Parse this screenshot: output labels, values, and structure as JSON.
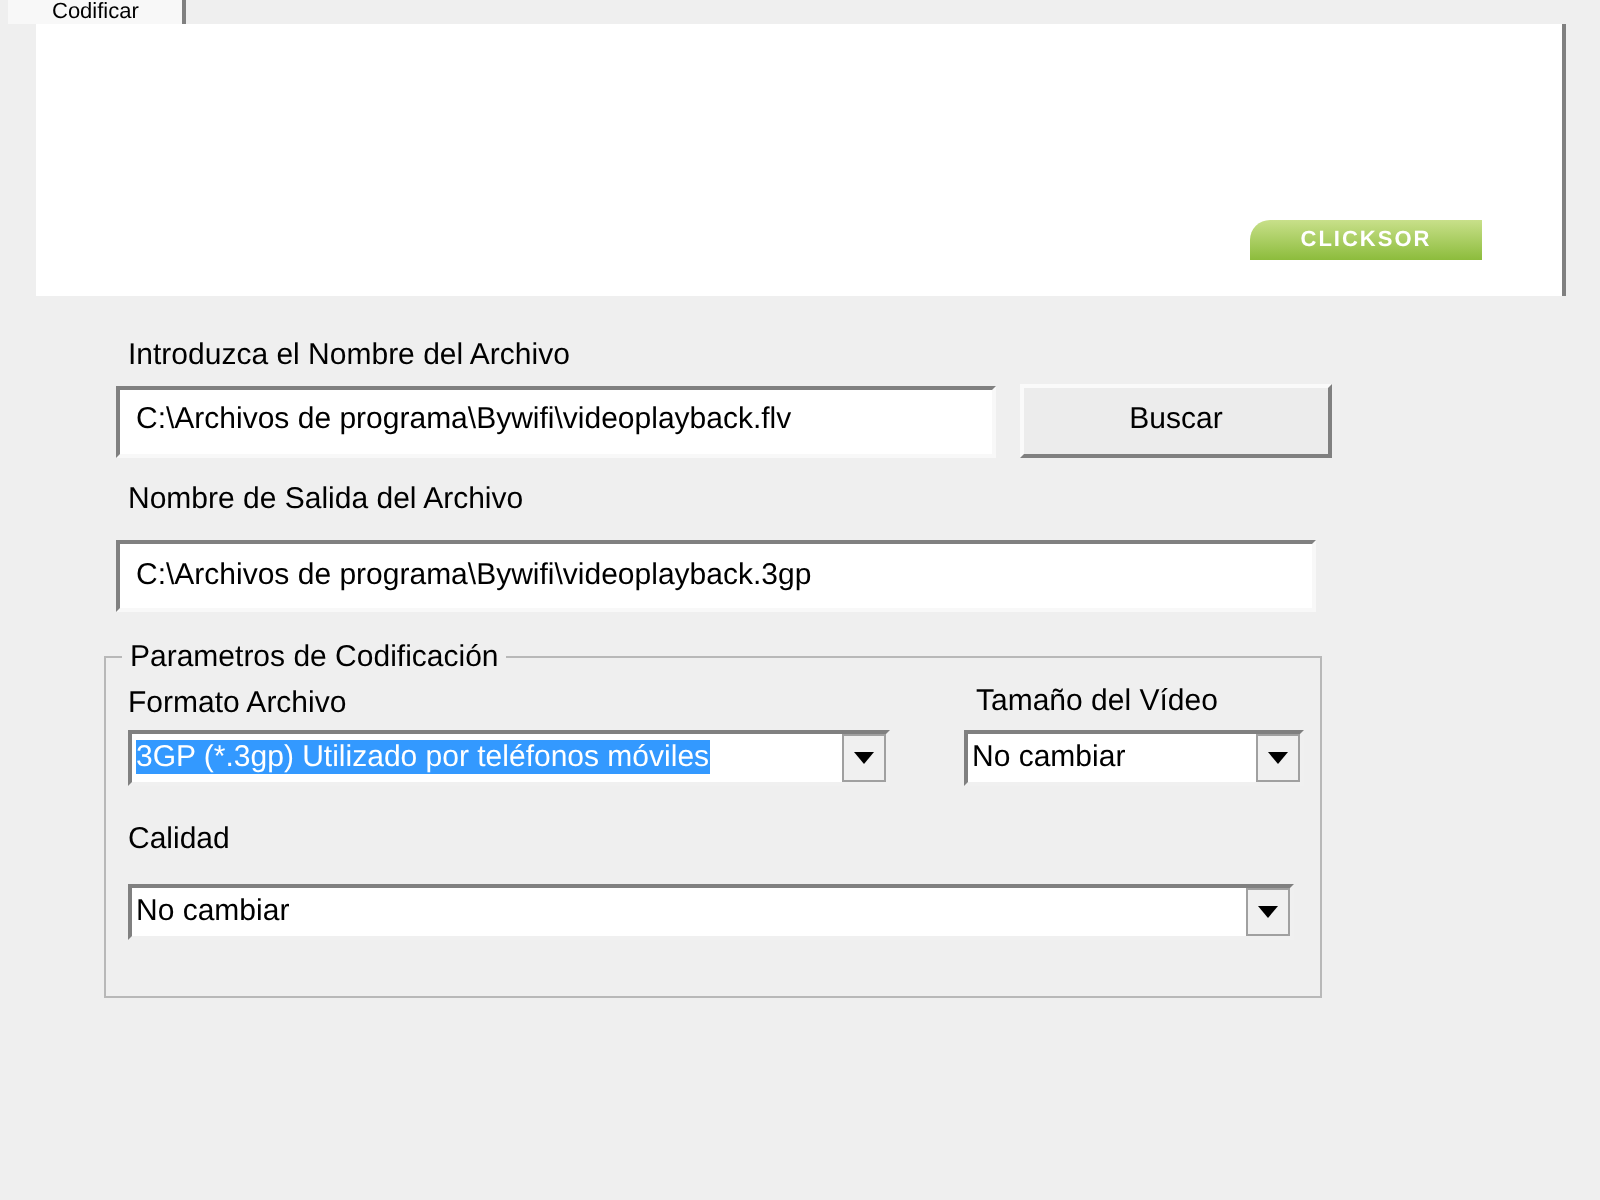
{
  "tabs": [
    {
      "label": "Codificar",
      "selected": true
    }
  ],
  "banner": {
    "logo": "CLICKSOR"
  },
  "input_file": {
    "label": "Introduzca el Nombre del Archivo",
    "value": "C:\\Archivos de programa\\Bywifi\\videoplayback.flv",
    "button": "Buscar"
  },
  "output_file": {
    "label": "Nombre de Salida del Archivo",
    "value": "C:\\Archivos de programa\\Bywifi\\videoplayback.3gp"
  },
  "encoding": {
    "title": "Parametros de Codificación",
    "format": {
      "label": "Formato Archivo",
      "value": "3GP (*.3gp)  Utilizado por teléfonos móviles",
      "highlighted": true
    },
    "video_size": {
      "label": "Tamaño del Vídeo",
      "value": "No cambiar",
      "highlighted": false
    },
    "quality": {
      "label": "Calidad",
      "value": "No cambiar",
      "highlighted": false
    }
  }
}
